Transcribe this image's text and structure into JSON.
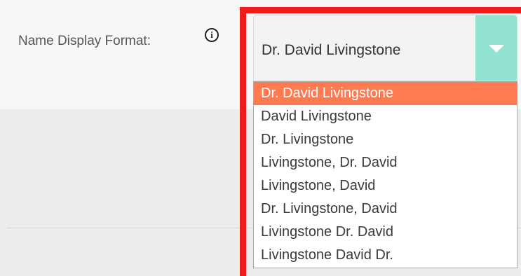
{
  "field": {
    "label": "Name Display Format:",
    "info_icon_glyph": "i"
  },
  "select": {
    "value": "Dr. David Livingstone",
    "options": [
      "Dr. David Livingstone",
      "David Livingstone",
      "Dr. Livingstone",
      "Livingstone, Dr. David",
      "Livingstone, David",
      "Dr. Livingstone, David",
      "Livingstone Dr. David",
      "Livingstone David Dr."
    ],
    "selected_index": 0
  },
  "colors": {
    "arrow_bg": "#93e3d2",
    "selected_option_bg": "#ff7a50",
    "highlight_frame": "#ee1c1c"
  }
}
